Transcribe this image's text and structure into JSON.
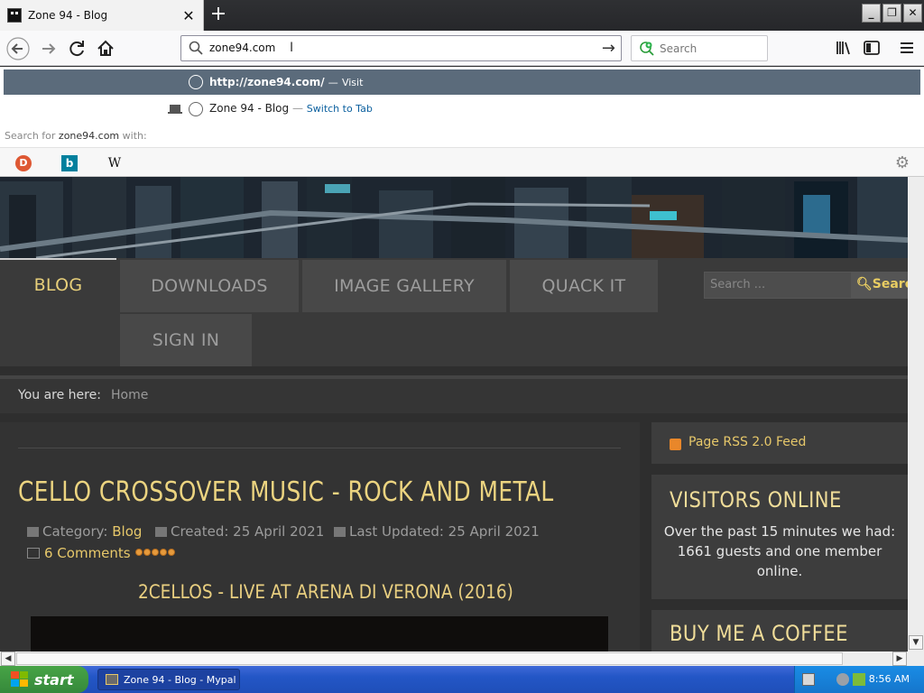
{
  "browser": {
    "tab_title": "Zone 94 - Blog",
    "new_tab": "+",
    "url_value": "zone94.com",
    "search_placeholder": "Search",
    "window_controls": {
      "minimize": "_",
      "restore": "❐",
      "close": "✕"
    }
  },
  "dropdown": {
    "visit_url": "http://zone94.com/",
    "visit_sep": "—",
    "visit_action": "Visit",
    "tab_title": "Zone 94 - Blog",
    "tab_sep": "—",
    "tab_action": "Switch to Tab",
    "search_for_prefix": "Search for",
    "search_for_term": "zone94.com",
    "search_for_suffix": "with:",
    "engines": [
      {
        "name": "duckduckgo",
        "glyph": "D"
      },
      {
        "name": "bing",
        "glyph": "b"
      },
      {
        "name": "wikipedia",
        "glyph": "W"
      }
    ]
  },
  "site": {
    "menu": [
      "BLOG",
      "DOWNLOADS",
      "IMAGE GALLERY",
      "QUACK IT",
      "SIGN IN"
    ],
    "search_placeholder": "Search ...",
    "search_button": "Search",
    "breadcrumb_label": "You are here:",
    "breadcrumb_home": "Home",
    "article": {
      "title": "CELLO CROSSOVER MUSIC - ROCK AND METAL",
      "category_label": "Category:",
      "category": "Blog",
      "created": "Created: 25 April 2021",
      "updated": "Last Updated: 25 April 2021",
      "comments": "6 Comments",
      "rating": 5,
      "subtitle": "2CELLOS - LIVE AT ARENA DI VERONA (2016)"
    },
    "sidebar": {
      "rss": "Page RSS 2.0 Feed",
      "visitors_title": "VISITORS ONLINE",
      "visitors_text": "Over the past 15 minutes we had: 1661 guests and one member online.",
      "coffee_title": "BUY ME A COFFEE"
    }
  },
  "taskbar": {
    "start": "start",
    "task": "Zone 94 - Blog - Mypal",
    "clock": "8:56 AM"
  },
  "colors": {
    "accent_gold": "#e7c86a",
    "dropdown_selected": "#5b6b7b",
    "taskbar_blue": "#2356c6"
  }
}
